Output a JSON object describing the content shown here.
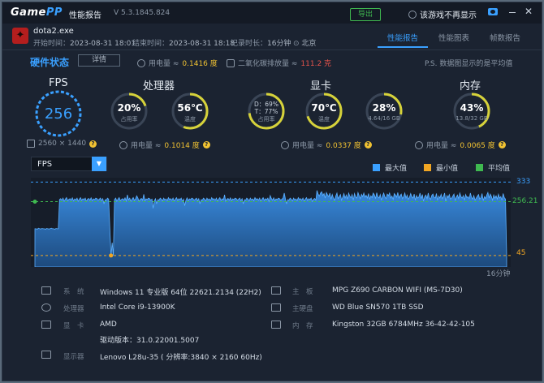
{
  "app": {
    "logo_main": "Game",
    "logo_accent": "PP",
    "report_title": "性能报告",
    "version": "V 5.3.1845.824",
    "export_label": "导出",
    "no_more_label": "该游戏不再显示"
  },
  "session": {
    "game_name": "dota2.exe",
    "start_label": "开始时间：",
    "start_value": "2023-08-31 18:01",
    "end_label": "结束时间：",
    "end_value": "2023-08-31 18:18",
    "duration_label": "记录时长：",
    "duration_value": "16分钟",
    "location": "北京"
  },
  "tabs": [
    {
      "label": "性能报告",
      "active": true
    },
    {
      "label": "性能图表",
      "active": false
    },
    {
      "label": "帧数报告",
      "active": false
    }
  ],
  "summary": {
    "hw_status": "硬件状态",
    "detail_button": "详情",
    "power_label": "用电量 ≈",
    "power_value": "0.1416 度",
    "co2_label": "二氧化碳排放量 ≈",
    "co2_value": "111.2 克",
    "note": "P.S. 数据图显示的是平均值"
  },
  "sections": {
    "fps": {
      "label": "FPS",
      "value": "256",
      "resolution": "2560 × 1440"
    },
    "cpu": {
      "label": "处理器",
      "usage_value": "20%",
      "usage_sub": "占用率",
      "usage_pct": 20,
      "temp_value": "56℃",
      "temp_sub": "温度",
      "temp_pct": 56,
      "power_label": "用电量 ≈",
      "power_value": "0.1014 度"
    },
    "gpu": {
      "label": "显卡",
      "dt_line1": "D：69%",
      "dt_line2": "T：77%",
      "dt_sub": "占用率",
      "dt_pct": 73,
      "temp_value": "70℃",
      "temp_sub": "温度",
      "temp_pct": 70,
      "vram_value": "28%",
      "vram_sub": "4.64/16 GB",
      "vram_pct": 28,
      "power_label": "用电量 ≈",
      "power_value": "0.0337 度"
    },
    "mem": {
      "label": "内存",
      "usage_value": "43%",
      "usage_sub": "13.8/32 GB",
      "usage_pct": 43,
      "power_label": "用电量 ≈",
      "power_value": "0.0065 度"
    }
  },
  "chart_controls": {
    "metric_selected": "FPS",
    "legend": [
      {
        "label": "最大值",
        "color": "#3aa0ff"
      },
      {
        "label": "最小值",
        "color": "#f1a623"
      },
      {
        "label": "平均值",
        "color": "#3fb950"
      }
    ]
  },
  "chart_data": {
    "type": "area",
    "max_label": "333",
    "avg_label": "256.21",
    "min_label": "45",
    "xlabel_end": "16分钟",
    "ylim": [
      0,
      350
    ],
    "max": 333,
    "avg": 256.21,
    "min": 45,
    "colors": {
      "area": "#3a8fe6",
      "max": "#3aa0ff",
      "min": "#f1a623",
      "avg": "#3fb950"
    },
    "values": [
      150,
      150,
      148,
      152,
      150,
      149,
      151,
      150,
      150,
      148,
      151,
      150,
      149,
      150,
      152,
      150,
      150,
      148,
      151,
      150,
      150,
      264,
      268,
      262,
      270,
      258,
      266,
      272,
      260,
      265,
      268,
      262,
      271,
      259,
      267,
      263,
      270,
      258,
      266,
      272,
      261,
      268,
      264,
      270,
      257,
      266,
      269,
      262,
      271,
      260,
      267,
      264,
      270,
      268,
      262,
      266,
      270,
      260,
      268,
      248,
      264,
      262,
      270,
      266,
      150,
      45,
      95,
      45,
      264,
      270,
      258,
      266,
      272,
      260,
      265,
      268,
      262,
      271,
      259,
      283,
      263,
      270,
      258,
      266,
      272,
      261,
      268,
      279,
      270,
      257,
      266,
      269,
      262,
      285,
      260,
      267,
      264,
      270,
      268,
      262,
      266,
      230,
      260,
      268,
      248,
      264,
      262,
      270,
      266,
      259,
      270,
      263,
      267,
      260,
      272,
      265,
      268,
      262,
      270,
      258,
      266,
      272,
      261,
      268,
      264,
      270,
      257,
      266,
      240,
      262,
      271,
      260,
      267,
      264,
      270,
      268,
      262,
      266,
      270,
      260,
      268,
      248,
      264,
      262,
      270,
      266,
      259,
      270,
      263,
      267,
      260,
      272,
      265,
      268,
      262,
      270,
      258,
      266,
      272,
      261,
      268,
      264,
      283,
      257,
      266,
      269,
      262,
      271,
      260,
      267,
      264,
      270,
      268,
      262,
      266,
      270,
      260,
      268,
      248,
      264,
      262,
      270,
      266,
      259,
      270,
      263,
      267,
      260,
      272,
      265,
      268,
      262,
      270,
      258,
      266,
      272,
      261,
      268,
      264,
      270,
      257,
      280,
      269,
      262,
      271,
      260,
      267,
      264,
      270,
      268,
      262,
      266,
      270,
      290,
      268,
      248,
      264,
      262,
      270,
      266,
      259,
      270,
      263,
      267,
      260,
      272,
      265,
      268,
      262,
      270,
      258,
      266,
      272,
      261,
      268,
      264,
      270,
      257,
      266,
      269,
      262,
      300,
      285,
      278,
      290,
      295,
      280,
      288,
      270,
      292,
      283,
      276,
      290,
      265,
      284,
      270,
      262,
      278,
      290,
      268,
      276,
      284,
      262,
      275,
      288,
      270,
      282,
      266,
      290,
      278,
      271,
      284,
      262,
      288,
      275,
      270,
      292,
      280,
      268,
      285,
      276,
      290,
      274,
      281,
      270,
      288,
      266,
      279,
      272,
      290,
      283,
      268,
      291,
      276,
      270,
      284,
      262,
      279,
      290,
      275,
      268,
      286,
      280,
      290,
      270,
      278,
      265,
      288,
      282,
      274,
      292,
      270,
      280,
      286,
      268,
      276,
      290,
      270,
      282,
      265,
      273,
      288,
      276,
      270,
      286,
      262,
      280,
      270,
      275,
      290,
      268,
      284,
      258,
      276,
      282,
      268,
      290,
      272,
      265,
      280,
      286,
      274,
      270,
      288,
      262,
      278,
      270,
      285,
      268,
      276,
      290,
      258,
      280,
      272,
      284,
      266,
      270,
      278,
      286,
      262,
      274,
      282,
      268,
      290,
      276,
      270,
      280,
      262,
      284,
      272,
      276,
      268,
      290,
      274,
      266,
      280,
      262,
      270,
      278,
      284,
      266,
      272,
      288,
      260,
      276,
      268,
      282,
      292,
      270,
      286,
      276,
      262,
      282,
      270,
      279,
      266,
      285,
      270,
      276,
      262,
      288,
      272,
      266,
      45
    ]
  },
  "system_info": {
    "left": [
      {
        "key": "系　统",
        "value": "Windows 11 专业版 64位 22621.2134 (22H2)"
      },
      {
        "key": "处理器",
        "value": "Intel Core i9-13900K"
      },
      {
        "key": "显　卡",
        "value": "AMD"
      },
      {
        "key": "",
        "value": "驱动版本：31.0.22001.5007"
      },
      {
        "key": "显示器",
        "value": "Lenovo L28u-35 ( 分辨率:3840 × 2160 60Hz)"
      }
    ],
    "right": [
      {
        "key": "主　板",
        "value": "MPG Z690 CARBON WIFI (MS-7D30)"
      },
      {
        "key": "主硬盘",
        "value": "WD Blue SN570 1TB SSD"
      },
      {
        "key": "内　存",
        "value": "Kingston 32GB 6784MHz 36-42-42-105"
      }
    ]
  }
}
